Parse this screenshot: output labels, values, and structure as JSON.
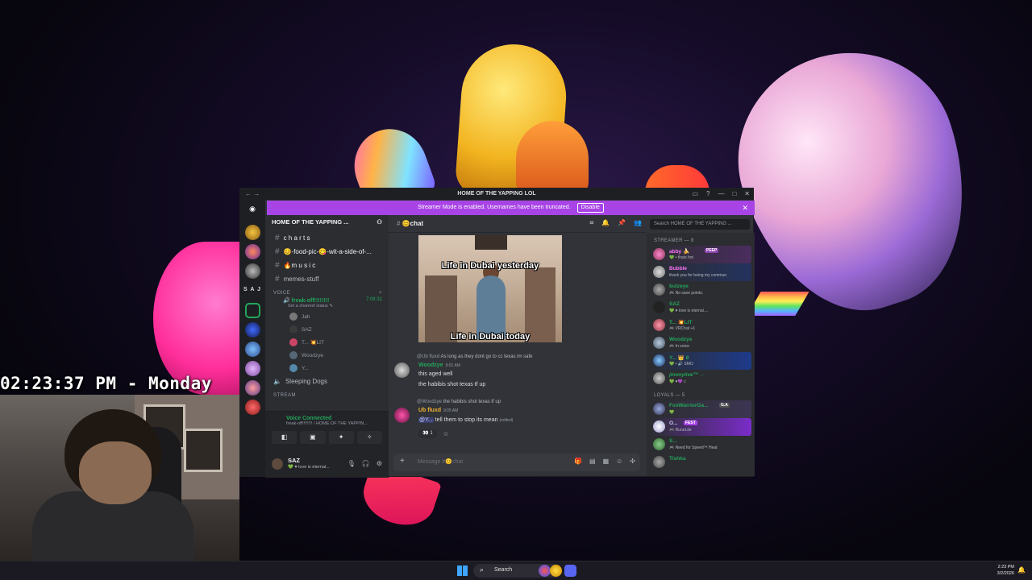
{
  "overlay": {
    "clock_text": "02:23:37 PM - Monday"
  },
  "window": {
    "title": "HOME OF THE YAPPING LOL",
    "back_icon": "arrow-left-icon",
    "banner_text": "Streamer Mode is enabled. Usernames have been truncated.",
    "banner_button": "Disable",
    "close_glyph": "✕"
  },
  "servers": {
    "logo_glyph": "◉",
    "label": "S A J"
  },
  "channels": {
    "server_name": "HOME OF THE YAPPING ...",
    "text_channels": [
      {
        "label": "c h a r t s",
        "bright": true
      },
      {
        "label": "😊-food-pic-😋-wit-a-side-of-...",
        "bright": true
      },
      {
        "label": "🔥m u s i c",
        "bright": true
      },
      {
        "label": "memes-stuff",
        "bright": false
      }
    ],
    "voice_category": "VOICE",
    "voice_channel": "freak-off!!!!!!!!",
    "voice_timer": "7:08:31",
    "voice_status": "Set a channel status ✎",
    "voice_users": [
      "Jah",
      "SAZ",
      "T... 💥LIT",
      "Woodzye",
      "Y..."
    ],
    "other_voice": "Sleeping Dogs",
    "stream_category": "STREAM"
  },
  "voice_panel": {
    "status": "Voice Connected",
    "location": "freak-off!!!!!!!! / HOME OF THE YAPPIN...",
    "buttons": [
      "◧",
      "▣",
      "✦",
      "✧"
    ]
  },
  "user_panel": {
    "name": "SAZ",
    "status": "💚 ♥ love is eternal..."
  },
  "chat": {
    "channel_name": "😊chat",
    "search_placeholder": "Search HOME OF THE YAPPING ...",
    "gif_top": "Life in Dubai yesterday",
    "gif_bottom": "Life in Dubai today",
    "messages": [
      {
        "reply_to": "@Ub fluxd",
        "reply_text": "As long as they dont go to cc texas im safe",
        "author": "Woodzye",
        "author_color": "#23a55a",
        "time": "9:01 AM",
        "lines": [
          "this aged well",
          "the habibis shot texas tf up"
        ]
      },
      {
        "reply_to": "@Woodzye",
        "reply_text": "the habibis shot texas tf up",
        "author": "Ub fluxd",
        "author_color": "#f0b232",
        "time": "9:05 AM",
        "mention": "@Y...",
        "text": "tell them to stop  its mean",
        "edited": "(edited)"
      }
    ],
    "reaction_count": "1",
    "composer_placeholder": "Message #😊chat"
  },
  "members": {
    "streamer_header": "STREAMER — 8",
    "streamers": [
      {
        "name": "abby 🍌",
        "status": "💚 • thats hot",
        "color": "#ff73fa",
        "tag": "PEEP"
      },
      {
        "name": "Bubble",
        "status": "thank you for being my commun",
        "color": "#ff73fa",
        "tag": ""
      },
      {
        "name": "bulzeye",
        "status": "🎮 No save points.",
        "color": "#23a55a",
        "tag": ""
      },
      {
        "name": "SAZ",
        "status": "💚 ♥ love is eternal....",
        "color": "#23a55a",
        "tag": ""
      },
      {
        "name": "T... 💥LIT",
        "status": "🎮 VRChat +1",
        "color": "#23a55a",
        "tag": ""
      },
      {
        "name": "Woodzye",
        "status": "🎮 In voice",
        "color": "#23a55a",
        "tag": ""
      },
      {
        "name": "Y... 👑 8",
        "status": "💚 • 🔊 SMO",
        "color": "#23a55a",
        "tag": ""
      },
      {
        "name": "jimmylive™ ←",
        "status": "💚 ♥💜 c",
        "color": "#23a55a",
        "tag": ""
      }
    ],
    "loyals_header": "LOYALS — 5",
    "loyals": [
      {
        "name": "FoxWarriorGa...",
        "status": "💚",
        "color": "#23a55a",
        "tag": "G.A"
      },
      {
        "name": "O...",
        "status": "🎮 RuneLite",
        "color": "#c9cdfb",
        "tag": "FEST"
      },
      {
        "name": "S...",
        "status": "🎮 Need for Speed™ Heat",
        "color": "#23a55a",
        "tag": ""
      },
      {
        "name": "Tishka",
        "status": "",
        "color": "#23a55a",
        "tag": ""
      }
    ]
  },
  "taskbar": {
    "search_label": "Search",
    "time": "2:23 PM",
    "date": "3/2/2026"
  }
}
